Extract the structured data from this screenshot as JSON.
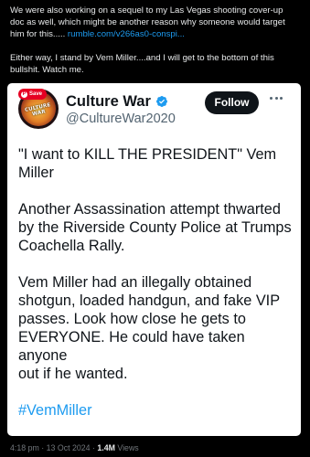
{
  "outer_post": {
    "line1": "We were also working on a sequel to my Las Vegas shooting cover-up",
    "line2": "doc as well, which might be another reason why someone would target",
    "line3_text": "him for this..... ",
    "line3_link": "rumble.com/v266as0-conspi...",
    "para2_line1": "Either way, I stand by Vem Miller....and I will get to the bottom of this",
    "para2_line2": "bullshit. Watch me."
  },
  "embedded_post": {
    "save_label": "Save",
    "avatar_text": "CULTURE WAR",
    "display_name": "Culture War",
    "handle": "@CultureWar2020",
    "follow_label": "Follow",
    "body": {
      "p1_l1": "\"I want to KILL THE PRESIDENT\" Vem",
      "p1_l2": "Miller",
      "p2_l1": "Another Assassination attempt thwarted",
      "p2_l2": "by the Riverside County Police at Trumps",
      "p2_l3": "Coachella Rally.",
      "p3_l1": "Vem Miller had an illegally obtained",
      "p3_l2": "shotgun, loaded handgun, and fake VIP",
      "p3_l3": "passes. Look how close he gets to",
      "p3_l4": "EVERYONE.  He could have taken anyone",
      "p3_l5": "out if he wanted.",
      "hashtag": "#VemMiller"
    }
  },
  "meta": {
    "time": "4:18 pm",
    "sep1": " · ",
    "date": "13 Oct 2024",
    "sep2": " · ",
    "views_count": "1.4M",
    "views_label": " Views"
  },
  "colors": {
    "background": "#000000",
    "link": "#1d9bf0",
    "verified": "#1d9bf0",
    "save_pill": "#e60023"
  },
  "icons": [
    "pinterest-icon",
    "verified-badge-icon",
    "more-options-icon"
  ]
}
